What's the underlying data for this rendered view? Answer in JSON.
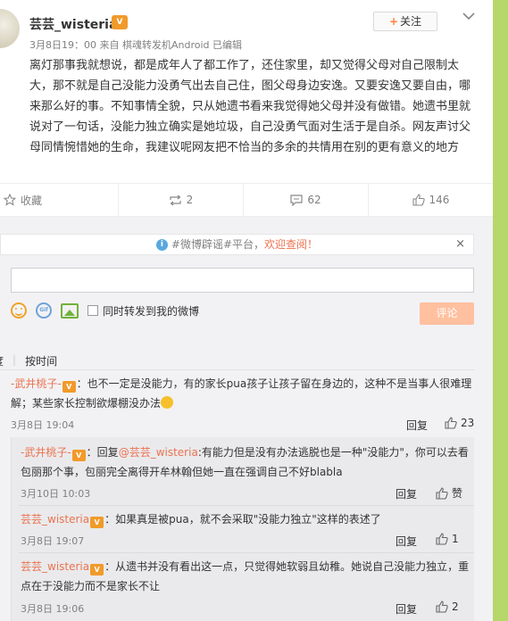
{
  "post": {
    "username": "芸芸_wisteria",
    "badge": "V",
    "follow_label": "关注",
    "follow_plus": "+",
    "meta": "3月8日19：00 来自 棋魂转发机Android 已编辑",
    "body": "离灯那事我就想说，都是成年人了都工作了，还住家里，却又觉得父母对自己限制太大，那不就是自己没能力没勇气出去自己住，图父母身边安逸。又要安逸又要自由，哪来那么好的事。不知事情全貌，只从她遗书看来我觉得她父母并没有做错。她遗书里就说对了一句话，没能力独立确实是她垃圾，自己没勇气面对生活于是自杀。网友声讨父母同情惋惜她的生命，我建议呢网友把不恰当的多余的共情用在别的更有意义的地方"
  },
  "actions": {
    "favorite": "收藏",
    "repost": "2",
    "comment": "62",
    "like": "146"
  },
  "notice": {
    "prefix": "#微博辟谣#平台，",
    "link": "欢迎查阅！",
    "close": "×"
  },
  "composer": {
    "input_value": "",
    "repost_label": "同时转发到我的微博",
    "submit_label": "评论"
  },
  "sort": {
    "first": "度",
    "second": "按时间"
  },
  "comments": [
    {
      "name": "-武井桃子-",
      "text": "：也不一定是没能力，有的家长pua孩子让孩子留在身边的，这种不是当事人很难理解；某些家长控制欲爆棚没办法",
      "date": "3月8日 19:04",
      "reply": "回复",
      "likes": "23"
    }
  ],
  "replies": [
    {
      "name": "-武井桃子-",
      "reply_prefix": "：回复",
      "mention": "@芸芸_wisteria",
      "text": ":有能力但是没有办法逃脱也是一种\"没能力\"，你可以去看包丽那个事，包丽完全离得开牟林翰但她一直在强调自己不好blabla",
      "date": "3月10日 10:03",
      "reply": "回复",
      "likes": "赞"
    },
    {
      "name": "芸芸_wisteria",
      "text": "：如果真是被pua，就不会采取\"没能力独立\"这样的表述了",
      "date": "3月8日 19:07",
      "reply": "回复",
      "likes": "1"
    },
    {
      "name": "芸芸_wisteria",
      "text": "：从遗书并没有看出这一点，只觉得她软弱且幼稚。她说自己没能力独立，重点在于没能力而不是家长不让",
      "date": "3月8日 19:06",
      "reply": "回复",
      "likes": "2"
    }
  ]
}
